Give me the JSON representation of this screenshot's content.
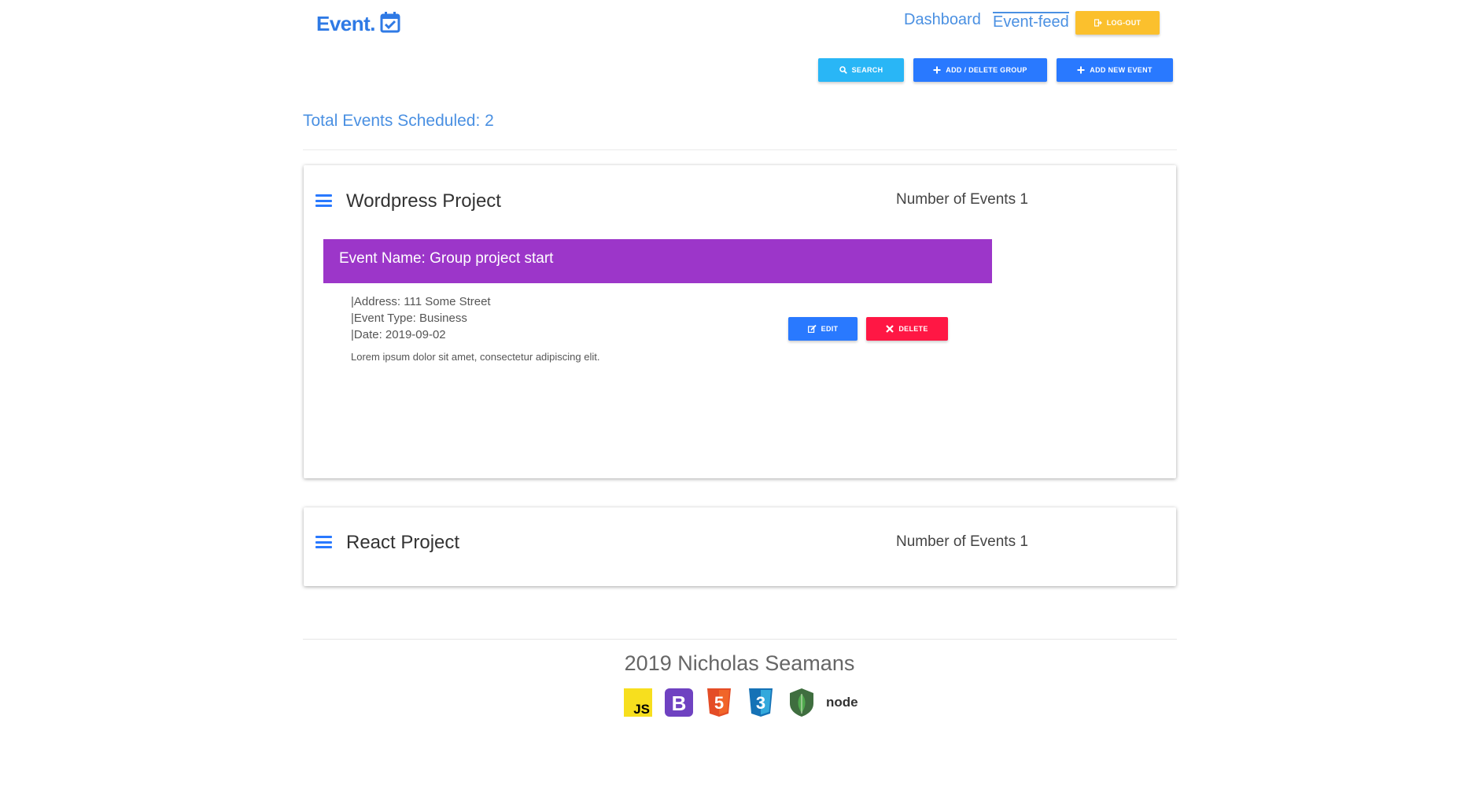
{
  "header": {
    "logo_text": "Event.",
    "logo_icon": "calendar-check-icon",
    "nav": {
      "dashboard": "Dashboard",
      "event_feed": "Event-feed"
    },
    "logout_label": "LOG-OUT"
  },
  "toolbar": {
    "search_label": "SEARCH",
    "group_label": "ADD / DELETE GROUP",
    "add_event_label": "ADD NEW EVENT"
  },
  "summary": {
    "total_text": "Total Events Scheduled: 2"
  },
  "groups": [
    {
      "title": "Wordpress Project",
      "count_text": "Number of Events 1",
      "events": [
        {
          "name_text": "Event Name: Group project start",
          "address_text": "|Address: 111 Some Street",
          "type_text": "|Event Type: Business",
          "date_text": "|Date: 2019-09-02",
          "description": "Lorem ipsum dolor sit amet, consectetur adipiscing elit.",
          "edit_label": "EDIT",
          "delete_label": "DELETE"
        }
      ]
    },
    {
      "title": "React Project",
      "count_text": "Number of Events 1"
    }
  ],
  "footer": {
    "text": "2019 Nicholas Seamans",
    "tech_icons": [
      "javascript-icon",
      "bootstrap-icon",
      "html5-icon",
      "css3-icon",
      "mongodb-icon",
      "nodejs-icon"
    ],
    "js_label": "JS",
    "bootstrap_label": "B",
    "html_label": "5",
    "css_label": "3",
    "node_label": "node"
  },
  "colors": {
    "primary": "#2979ff",
    "link": "#4a90e2",
    "logout": "#fbc02d",
    "search": "#29b6f6",
    "event_header": "#9c36c9",
    "delete": "#ff1744"
  }
}
